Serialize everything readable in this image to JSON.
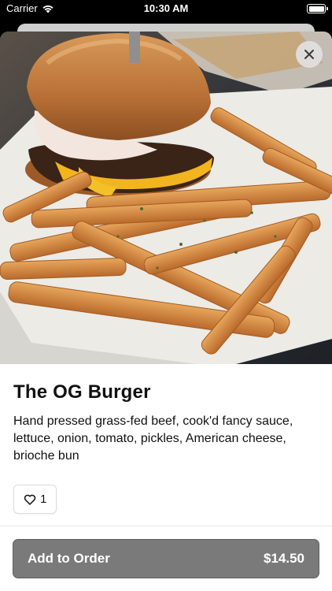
{
  "status_bar": {
    "carrier": "Carrier",
    "time": "10:30 AM",
    "battery_level": 1.0
  },
  "item": {
    "photo_icon": "burger-and-fries-photo",
    "title": "The OG Burger",
    "description": "Hand pressed grass-fed beef, cook'd fancy sauce, lettuce, onion, tomato, pickles, American cheese, brioche bun",
    "likes": "1",
    "like_icon": "heart-outline-icon"
  },
  "actions": {
    "close_icon": "close-icon",
    "add_label": "Add to Order",
    "price": "$14.50",
    "add_button_color": "#7a7a7a"
  }
}
